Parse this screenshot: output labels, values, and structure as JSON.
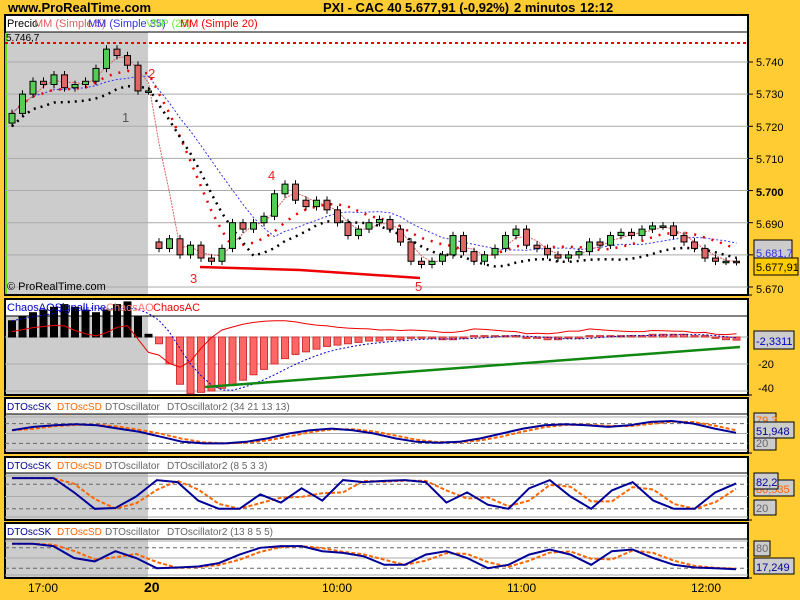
{
  "header": {
    "site": "www.ProRealTime.com",
    "title": "PXI - CAC 40",
    "price": "5.677,91 (-0,92%)",
    "interval": "2 minutos",
    "time": "12:12"
  },
  "panels": {
    "price": {
      "labels": [
        "Precio",
        "MM (Simple 5)",
        "MM (Simple 35)",
        "VNP (25)",
        "MM (Simple 20)"
      ],
      "high_label": "5.746,7",
      "watermark": "© ProRealTime.com",
      "ma_value": "5.681,7",
      "last_value": "5.677,91",
      "ticks": [
        "5.740",
        "5.730",
        "5.720",
        "5.710",
        "5.700",
        "5.690",
        "5.670"
      ],
      "annotations": [
        "1",
        "2",
        "3",
        "4",
        "5"
      ]
    },
    "chaos": {
      "labels": [
        "ChaosAOSignalLine",
        "ChaosAO",
        "ChaosAC"
      ],
      "value": "-2,3311",
      "ticks": [
        "-20",
        "-40"
      ]
    },
    "dto1": {
      "labels": [
        "DTOscSK",
        "DTOscSD",
        "DTOscillator",
        "DTOscillator2 (34 21 13 13)"
      ],
      "value_sd": "79,3",
      "value_sk": "51,948",
      "value_low": "20"
    },
    "dto2": {
      "labels": [
        "DTOscSK",
        "DTOscSD",
        "DTOscillator",
        "DTOscillator2 (8 5 3 3)"
      ],
      "value_sk": "82,2",
      "value_sd": "80,535",
      "value_low": "20"
    },
    "dto3": {
      "labels": [
        "DTOscSK",
        "DTOscSD",
        "DTOscillator",
        "DTOscillator2 (13 8 5 5)"
      ],
      "value_high": "80",
      "value_sk": "17,249"
    }
  },
  "time_axis": [
    "17:00",
    "20",
    "10:00",
    "11:00",
    "12:00"
  ],
  "colors": {
    "background": "#FFCC33",
    "up": "#55CC55",
    "down": "#DD6666",
    "session": "#CCCCCC"
  },
  "chart_data": {
    "type": "candlestick",
    "title": "PXI - CAC 40",
    "ylim": [
      5.667,
      5.748
    ],
    "closes": [
      5.724,
      5.73,
      5.734,
      5.733,
      5.736,
      5.732,
      5.733,
      5.734,
      5.738,
      5.744,
      5.742,
      5.739,
      5.731,
      5.731,
      5.682,
      5.685,
      5.68,
      5.683,
      5.679,
      5.678,
      5.682,
      5.69,
      5.688,
      5.69,
      5.692,
      5.699,
      5.702,
      5.697,
      5.695,
      5.697,
      5.694,
      5.69,
      5.686,
      5.688,
      5.69,
      5.691,
      5.688,
      5.684,
      5.678,
      5.677,
      5.678,
      5.68,
      5.686,
      5.681,
      5.678,
      5.68,
      5.682,
      5.686,
      5.688,
      5.683,
      5.682,
      5.68,
      5.679,
      5.68,
      5.681,
      5.684,
      5.683,
      5.686,
      5.687,
      5.686,
      5.688,
      5.689,
      5.689,
      5.686,
      5.684,
      5.682,
      5.679,
      5.678,
      5.678,
      5.6779
    ],
    "ao": [
      12,
      15,
      18,
      20,
      22,
      24,
      22,
      20,
      18,
      20,
      24,
      26,
      15,
      2,
      -5,
      -20,
      -35,
      -42,
      -41,
      -40,
      -38,
      -36,
      -32,
      -28,
      -24,
      -20,
      -16,
      -13,
      -11,
      -9,
      -7,
      -6,
      -5,
      -4,
      -3,
      -3,
      -2,
      -2,
      -1,
      -1,
      -1,
      -2,
      -2,
      -1,
      1,
      1,
      1,
      1,
      1,
      -1,
      -1,
      -2,
      -2,
      -1,
      -1,
      1,
      1,
      1,
      1,
      1,
      1,
      2,
      2,
      2,
      2,
      1,
      1,
      -1,
      -2,
      -2.3311
    ],
    "dto1_sk": [
      60,
      70,
      75,
      78,
      75,
      65,
      55,
      40,
      25,
      20,
      20,
      25,
      35,
      50,
      60,
      65,
      60,
      50,
      35,
      25,
      22,
      25,
      35,
      50,
      65,
      75,
      78,
      75,
      70,
      75,
      85,
      88,
      80,
      65,
      52
    ],
    "dto2_sk": [
      95,
      95,
      95,
      60,
      20,
      22,
      50,
      90,
      85,
      40,
      20,
      20,
      55,
      35,
      70,
      40,
      90,
      85,
      88,
      90,
      85,
      35,
      60,
      30,
      20,
      70,
      90,
      50,
      20,
      65,
      85,
      40,
      20,
      20,
      60,
      82
    ],
    "dto3_sk": [
      92,
      92,
      85,
      50,
      40,
      70,
      50,
      20,
      22,
      25,
      35,
      60,
      80,
      85,
      85,
      70,
      65,
      55,
      30,
      30,
      60,
      70,
      50,
      20,
      30,
      60,
      75,
      60,
      30,
      70,
      75,
      50,
      30,
      22,
      20,
      17
    ]
  }
}
